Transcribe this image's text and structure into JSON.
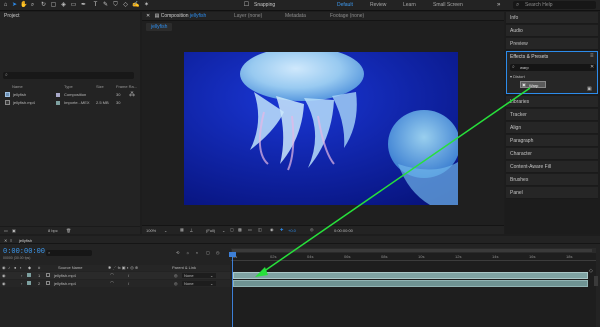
{
  "toolbar": {
    "snapping_label": "Snapping",
    "workspaces": [
      "Default",
      "Review",
      "Learn",
      "Small Screen"
    ],
    "active_workspace": "Default",
    "search_placeholder": "Search Help"
  },
  "project_panel": {
    "title": "Project",
    "columns": [
      "Name",
      "Type",
      "Size",
      "Frame Ra..."
    ],
    "items": [
      {
        "name": "jellyfish",
        "type": "Composition",
        "size": "",
        "fps": "30"
      },
      {
        "name": "jellyfish.mp4",
        "type": "Importe...MEX",
        "size": "2.5 MB",
        "fps": "30"
      }
    ],
    "footer": "8 bpc"
  },
  "composition_panel": {
    "tab_label": "Composition",
    "tab_name": "jellyfish",
    "other_tabs": [
      "Layer (none)",
      "Metadata",
      "Footage (none)"
    ],
    "breadcrumb": "jellyfish",
    "zoom": "100%",
    "resolution": "(Full)",
    "timecode": "0:00:00:00"
  },
  "right_panel": {
    "items_top": [
      "Info",
      "Audio",
      "Preview"
    ],
    "effects_title": "Effects & Presets",
    "effects_search": "warp",
    "effects_category": "Distort",
    "effects_result": "Warp",
    "items_bottom": [
      "Libraries",
      "Tracker",
      "Align",
      "Paragraph",
      "Character",
      "Content-Aware Fill",
      "Brushes",
      "Panel"
    ]
  },
  "timeline": {
    "tab": "jellyfish",
    "timecode": "0:00:00:00",
    "timecode_sub": "00000 (30.00 fps)",
    "col_source": "Source Name",
    "col_parent": "Parent & Link",
    "layers": [
      {
        "num": "1",
        "name": "jellyfish.mp4",
        "parent": "None"
      },
      {
        "num": "2",
        "name": "jellyfish.mp4",
        "parent": "None"
      }
    ],
    "ruler": [
      "0s",
      "02s",
      "04s",
      "06s",
      "08s",
      "10s",
      "12s",
      "14s",
      "16s",
      "18s",
      "20s"
    ]
  }
}
